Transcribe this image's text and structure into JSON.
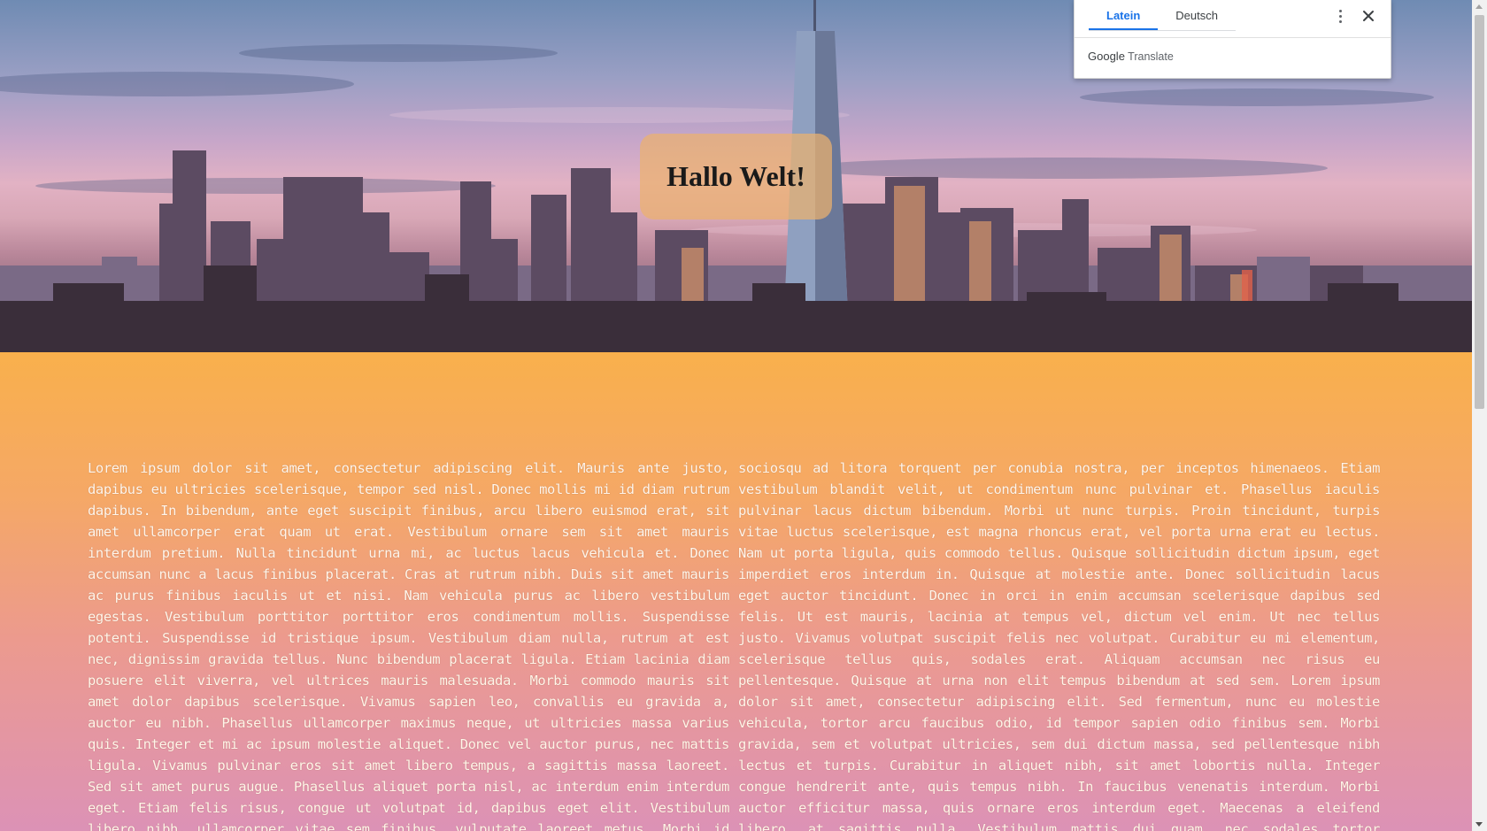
{
  "hero": {
    "title": "Hallo Welt!"
  },
  "translate_popup": {
    "tabs": [
      {
        "label": "Latein",
        "active": true
      },
      {
        "label": "Deutsch",
        "active": false
      }
    ],
    "brand_google": "Google",
    "brand_translate": "Translate",
    "icons": {
      "menu": "more-vert-icon",
      "close": "close-icon"
    },
    "accent_color": "#1a73e8"
  },
  "content": {
    "column_left": "Lorem ipsum dolor sit amet, consectetur adipiscing elit. Mauris ante justo, dapibus eu ultricies scelerisque, tempor sed nisl. Donec mollis mi id diam rutrum dapibus. In bibendum, ante eget suscipit finibus, arcu libero euismod erat, sit amet ullamcorper erat quam ut erat. Vestibulum ornare sem sit amet mauris interdum pretium. Nulla tincidunt urna mi, ac luctus lacus vehicula et. Donec accumsan nunc a lacus finibus placerat. Cras at rutrum nibh. Duis sit amet mauris ac purus finibus iaculis ut et nisi. Nam vehicula purus ac libero vestibulum egestas. Vestibulum porttitor porttitor eros condimentum mollis. Suspendisse potenti. Suspendisse id tristique ipsum. Vestibulum diam nulla, rutrum at est nec, dignissim gravida tellus. Nunc bibendum placerat ligula. Etiam lacinia diam posuere elit viverra, vel ultrices mauris malesuada. Morbi commodo mauris sit amet dolor dapibus scelerisque. Vivamus sapien leo, convallis eu gravida a, auctor eu nibh. Phasellus ullamcorper maximus neque, ut ultricies massa varius quis. Integer et mi ac ipsum molestie aliquet. Donec vel auctor purus, nec mattis ligula. Vivamus pulvinar eros sit amet libero tempus, a sagittis massa laoreet. Sed sit amet purus augue. Phasellus aliquet porta nisl, ac interdum enim interdum eget. Etiam felis risus, congue ut volutpat id, dapibus eget elit. Vestibulum libero nibh, ullamcorper vitae sem finibus, vulputate laoreet metus. Morbi id porttitor elit, vel",
    "column_right": "sociosqu ad litora torquent per conubia nostra, per inceptos himenaeos. Etiam vestibulum blandit velit, ut condimentum nunc pulvinar et. Phasellus iaculis pulvinar lacus dictum bibendum. Morbi ut nunc turpis. Proin tincidunt, turpis vitae luctus scelerisque, est magna rhoncus erat, vel porta urna erat eu lectus. Nam ut porta ligula, quis commodo tellus. Quisque sollicitudin dictum ipsum, eget imperdiet eros interdum in. Quisque at molestie ante. Donec sollicitudin lacus eget auctor tincidunt. Donec in orci in enim accumsan scelerisque dapibus sed felis. Ut est mauris, lacinia at tempus vel, dictum vel enim. Ut nec tellus justo. Vivamus volutpat suscipit felis nec volutpat. Curabitur eu mi elementum, scelerisque tellus quis, sodales erat. Aliquam accumsan nec risus eu pellentesque. Quisque at urna non elit tempus bibendum at sed sem. Lorem ipsum dolor sit amet, consectetur adipiscing elit. Sed fermentum, nunc eu molestie vehicula, tortor arcu faucibus odio, id tempor sapien odio finibus sem. Morbi gravida, sem et volutpat ultricies, sem dui dictum massa, sed pellentesque nibh lectus et turpis. Curabitur in aliquet nibh, sit amet lobortis nulla. Integer congue hendrerit ante, quis tempus nibh. In faucibus venenatis interdum. Morbi auctor efficitur massa, quis ornare eros interdum eget. Maecenas a eleifend libero, at sagittis nulla. Vestibulum mattis dui quam, nec sodales tortor placerat eu. Ut blandit mauris a"
  }
}
